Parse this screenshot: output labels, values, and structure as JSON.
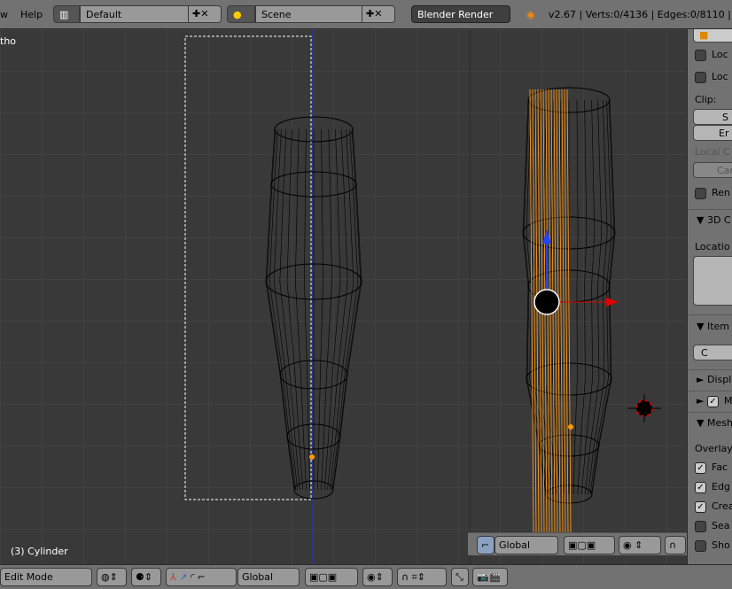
{
  "topbar": {
    "menu": [
      "w",
      "Help"
    ],
    "layout": "Default",
    "scene": "Scene",
    "engine": "Blender Render",
    "stats": "v2.67 | Verts:0/4136 | Edges:0/8110 | Fa"
  },
  "viewport": {
    "view_label": "tho",
    "object_label": "(3) Cylinder"
  },
  "panel": {
    "rows": [
      "Loc",
      "Loc"
    ],
    "clip": "Clip:",
    "clip_start": "S",
    "clip_end": "Er",
    "local_camera": "Local C",
    "camera": "Cam",
    "render": "Ren",
    "cursor_header": "3D C",
    "location": "Locatio",
    "location_x": "",
    "item_header": "Item",
    "item_name": "C",
    "display_header": "Displ",
    "m_header": "M",
    "mesh_header": "Mesh",
    "overlays": "Overlay",
    "overlay_items": [
      {
        "label": "Fac",
        "checked": true
      },
      {
        "label": "Edg",
        "checked": true
      },
      {
        "label": "Crea",
        "checked": true
      },
      {
        "label": "Sea",
        "checked": false
      },
      {
        "label": "Sho",
        "checked": false
      }
    ]
  },
  "mini_header": {
    "orientation": "Global"
  },
  "bottombar": {
    "mode": "Edit Mode",
    "orientation": "Global"
  },
  "colors": {
    "selection": "#ff9a1a",
    "x_axis": "#dd0000",
    "z_axis": "#2244ff"
  }
}
